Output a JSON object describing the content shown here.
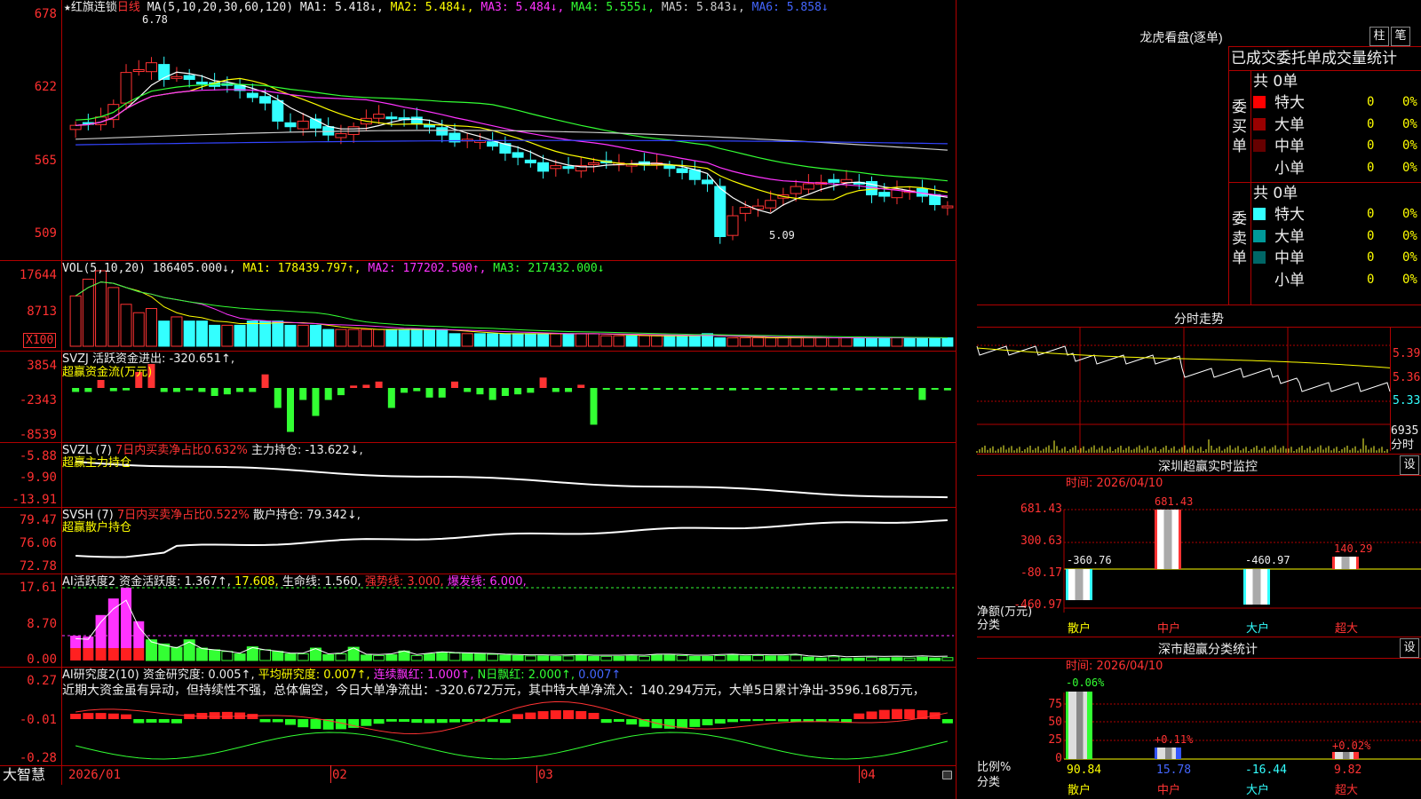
{
  "kline": {
    "title_star": "★",
    "stock_name": "红旗连锁",
    "period": "日线",
    "ma_label": "MA(5,10,20,30,60,120)",
    "ma1": "MA1: 5.418↓,",
    "ma2": "MA2: 5.484↓,",
    "ma3": "MA3: 5.484↓,",
    "ma4": "MA4: 5.555↓,",
    "ma5": "MA5: 5.843↓,",
    "ma6": "MA6: 5.858↓",
    "high_label": "6.78",
    "low_label": "5.09",
    "axis": [
      "678",
      "622",
      "565",
      "509"
    ]
  },
  "vol": {
    "label": "VOL(5,10,20)",
    "value": "186405.000↓,",
    "ma1": "MA1: 178439.797↑,",
    "ma2": "MA2: 177202.500↑,",
    "ma3": "MA3: 217432.000↓",
    "axis": [
      "17644",
      "8713"
    ],
    "unit": "X100"
  },
  "svzj": {
    "label": "SVZJ  活跃资金进出: -320.651↑,",
    "sub": "超赢资金流(万元)",
    "axis": [
      "3854",
      "-2343",
      "-8539"
    ],
    "values": [
      -0.5,
      -0.5,
      1,
      -0.4,
      -0.3,
      2,
      3,
      -0.5,
      -0.5,
      -0.3,
      -0.5,
      -1,
      -0.8,
      -0.5,
      -0.5,
      1.7,
      -2.5,
      -5.5,
      -1.5,
      -3.5,
      -1.5,
      -0.9,
      0.3,
      0.4,
      0.8,
      -2.5,
      -0.6,
      -0.4,
      -1.2,
      -1.2,
      0.8,
      -0.5,
      -0.8,
      -1.5,
      -1,
      -0.8,
      -0.6,
      1.3,
      -0.5,
      -0.5,
      0.4,
      -4.6,
      -0.2,
      -0.2,
      -0.2,
      -0.2,
      -0.2,
      -0.2,
      -0.2,
      -0.2,
      -0.2,
      -0.2,
      -0.3,
      -0.2,
      -0.2,
      -0.2,
      -0.2,
      -0.2,
      -0.2,
      -0.2,
      -0.3,
      -0.2,
      -0.3,
      -0.2,
      -0.2,
      -0.2,
      -0.2,
      -1.5,
      -0.2,
      -0.3
    ]
  },
  "svzl": {
    "label": "SVZL (7)",
    "desc": "7日内买卖净占比0.632%",
    "hold": "主力持仓: -13.622↓,",
    "sub": "超赢主力持仓",
    "axis": [
      "-5.88",
      "-9.90",
      "-13.91"
    ]
  },
  "svsh": {
    "label": "SVSH (7)",
    "desc": "7日内买卖净占比0.522%",
    "hold": "散户持仓: 79.342↓,",
    "sub": "超赢散户持仓",
    "axis": [
      "79.47",
      "76.06",
      "72.78"
    ]
  },
  "ai1": {
    "label": "AI活跃度2",
    "f1": "资金活跃度: 1.367↑,",
    "f2": "17.608,",
    "f3": "生命线: 1.560,",
    "f4": "强势线: 3.000,",
    "f5": "爆发线: 6.000,",
    "axis": [
      "17.61",
      "8.70",
      "0.00"
    ]
  },
  "ai2": {
    "label": "AI研究度2(10)",
    "f1": "资金研究度: 0.005↑,",
    "f2": "平均研究度: 0.007↑,",
    "f3": "连续飘红: 1.000↑,",
    "f4": "N日飘红: 2.000↑,",
    "f5": "0.007↑",
    "comment": "近期大资金虽有异动，但持续性不强，总体偏空，今日大单净流出：-320.672万元，其中特大单净流入：140.294万元，大单5日累计净出-3596.168万元，",
    "axis": [
      "0.27",
      "-0.01",
      "-0.28"
    ]
  },
  "xaxis": {
    "brand": "大智慧",
    "labels": [
      "2026/01",
      "02",
      "03",
      "04"
    ]
  },
  "dragon": {
    "title": "龙虎看盘(逐单)",
    "btn1": "柱",
    "btn2": "笔",
    "header": "已成交委托单成交量统计",
    "buy_side": "委买单",
    "sell_side": "委卖单",
    "buy_total": "共 0单",
    "sell_total": "共 0单",
    "buy_rows": [
      {
        "name": "特大",
        "vol": "0",
        "pct": "0%",
        "color": "#ff0000"
      },
      {
        "name": "大单",
        "vol": "0",
        "pct": "0%",
        "color": "#990000"
      },
      {
        "name": "中单",
        "vol": "0",
        "pct": "0%",
        "color": "#660000"
      },
      {
        "name": "小单",
        "vol": "0",
        "pct": "0%",
        "color": "#000000"
      }
    ],
    "sell_rows": [
      {
        "name": "特大",
        "vol": "0",
        "pct": "0%",
        "color": "#33ffff"
      },
      {
        "name": "大单",
        "vol": "0",
        "pct": "0%",
        "color": "#009999"
      },
      {
        "name": "中单",
        "vol": "0",
        "pct": "0%",
        "color": "#006666"
      },
      {
        "name": "小单",
        "vol": "0",
        "pct": "0%",
        "color": "#000000"
      }
    ]
  },
  "intraday": {
    "title": "分时走势",
    "axis": [
      "5.39",
      "5.36",
      "5.33"
    ],
    "vol_max": "6935",
    "vol_label": "分时"
  },
  "sz_monitor": {
    "title": "深圳超赢实时监控",
    "btn": "设",
    "date": "时间: 2026/04/10",
    "axis": [
      "681.43",
      "300.63",
      "-80.17",
      "-460.97"
    ],
    "bar_labels": [
      "-360.76",
      "681.43",
      "-460.97",
      "140.29"
    ],
    "y_label": "净额(万元)",
    "cat_label": "分类",
    "categories": [
      "散户",
      "中户",
      "大户",
      "超大"
    ]
  },
  "sz_class": {
    "title": "深市超赢分类统计",
    "btn": "设",
    "date": "时间: 2026/04/10",
    "axis": [
      "75",
      "50",
      "25",
      "0"
    ],
    "bar_top_labels": [
      "-0.06%",
      "+0.11%",
      "",
      "+0.02%"
    ],
    "values": [
      "90.84",
      "15.78",
      "-16.44",
      "9.82"
    ],
    "y_label": "比例%",
    "cat_label": "分类",
    "categories": [
      "散户",
      "中户",
      "大户",
      "超大"
    ]
  }
}
